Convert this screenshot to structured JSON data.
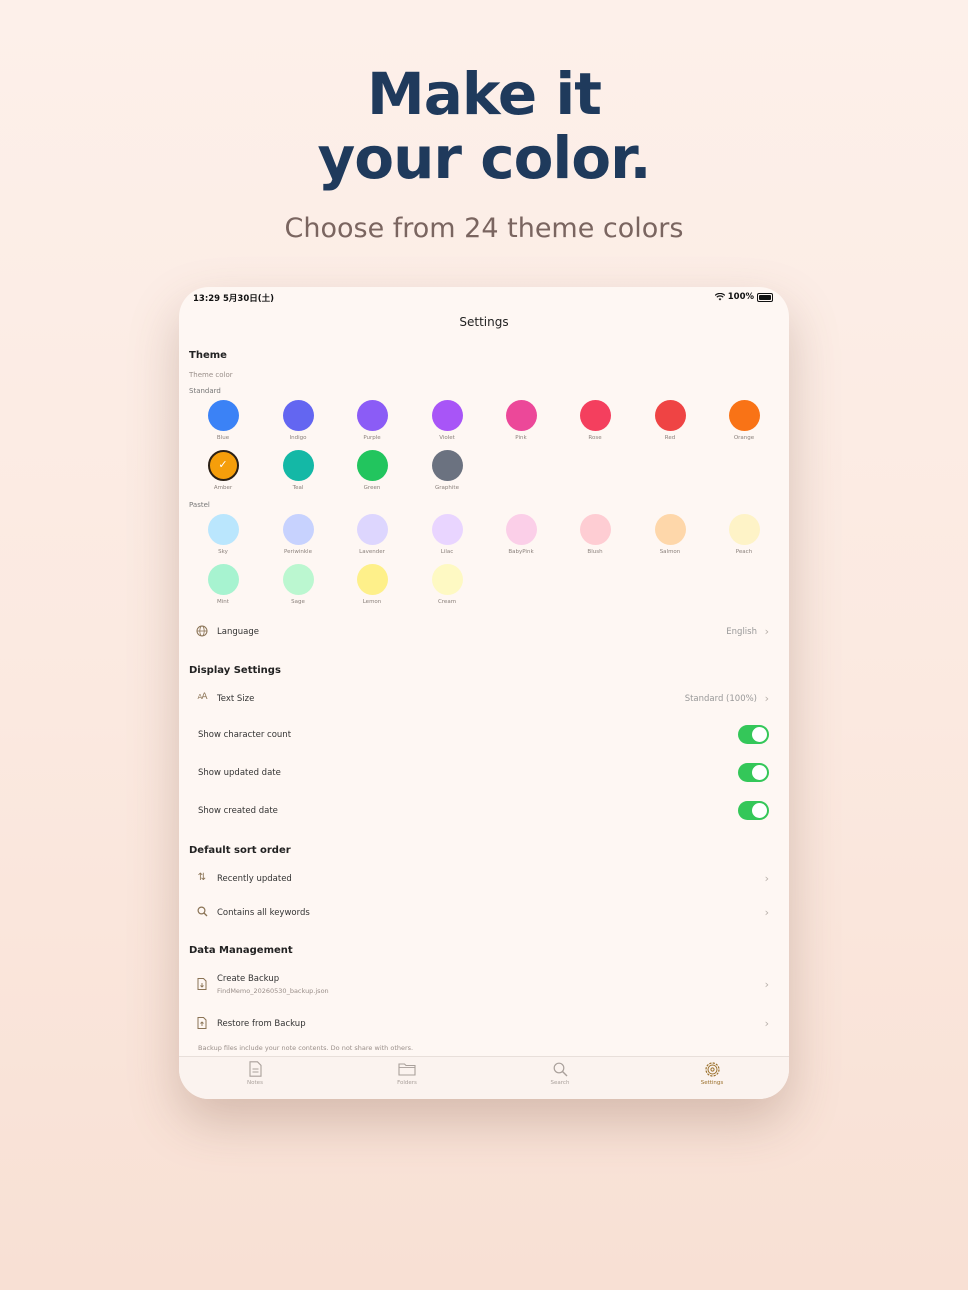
{
  "hero": {
    "title_line1": "Make it",
    "title_line2": "your color.",
    "subtitle": "Choose from 24 theme colors"
  },
  "status_bar": {
    "time_date": "13:29  5月30日(土)",
    "battery": "100%"
  },
  "nav": {
    "title": "Settings"
  },
  "theme": {
    "section_title": "Theme",
    "theme_color_label": "Theme color",
    "standard_label": "Standard",
    "pastel_label": "Pastel",
    "selected": "Amber",
    "standard": [
      {
        "name": "Blue",
        "color": "#3b82f6"
      },
      {
        "name": "Indigo",
        "color": "#6366f1"
      },
      {
        "name": "Purple",
        "color": "#8b5cf6"
      },
      {
        "name": "Violet",
        "color": "#a855f7"
      },
      {
        "name": "Pink",
        "color": "#ec4899"
      },
      {
        "name": "Rose",
        "color": "#f43f5e"
      },
      {
        "name": "Red",
        "color": "#ef4444"
      },
      {
        "name": "Orange",
        "color": "#f97316"
      },
      {
        "name": "Amber",
        "color": "#f59e0b"
      },
      {
        "name": "Teal",
        "color": "#14b8a6"
      },
      {
        "name": "Green",
        "color": "#22c55e"
      },
      {
        "name": "Graphite",
        "color": "#6b7280"
      }
    ],
    "pastel": [
      {
        "name": "Sky",
        "color": "#bae6fd"
      },
      {
        "name": "Periwinkle",
        "color": "#c7d2fe"
      },
      {
        "name": "Lavender",
        "color": "#ddd6fe"
      },
      {
        "name": "Lilac",
        "color": "#e9d5ff"
      },
      {
        "name": "BabyPink",
        "color": "#fbcfe8"
      },
      {
        "name": "Blush",
        "color": "#fecdd3"
      },
      {
        "name": "Salmon",
        "color": "#fed7aa"
      },
      {
        "name": "Peach",
        "color": "#fef3c7"
      },
      {
        "name": "Mint",
        "color": "#a7f3d0"
      },
      {
        "name": "Sage",
        "color": "#bbf7d0"
      },
      {
        "name": "Lemon",
        "color": "#fef08a"
      },
      {
        "name": "Cream",
        "color": "#fef9c3"
      }
    ]
  },
  "language": {
    "label": "Language",
    "value": "English"
  },
  "display": {
    "section_title": "Display Settings",
    "text_size_label": "Text Size",
    "text_size_value": "Standard (100%)",
    "show_character_count": "Show character count",
    "show_updated_date": "Show updated date",
    "show_created_date": "Show created date"
  },
  "sort": {
    "section_title": "Default sort order",
    "sort_label": "Recently updated",
    "search_label": "Contains all keywords"
  },
  "data": {
    "section_title": "Data Management",
    "create_backup": "Create Backup",
    "create_backup_file": "FindMemo_20260530_backup.json",
    "restore_backup": "Restore from Backup",
    "footnote": "Backup files include your note contents. Do not share with others."
  },
  "tabs": {
    "notes": "Notes",
    "folders": "Folders",
    "search": "Search",
    "settings": "Settings"
  },
  "colors": {
    "toggle_on": "#34c759",
    "accent": "#9a6f2a",
    "hero_title": "#1f3a5c"
  }
}
